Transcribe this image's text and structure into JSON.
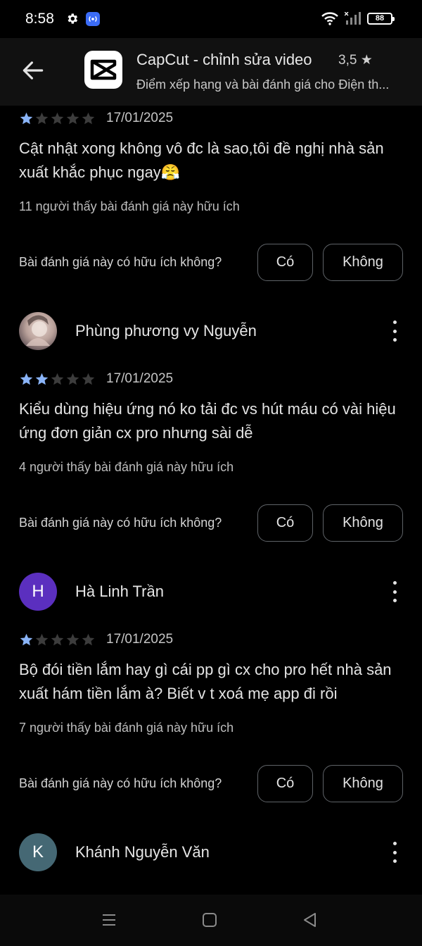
{
  "status_bar": {
    "time": "8:58",
    "battery": "88"
  },
  "header": {
    "app_title": "CapCut - chỉnh sửa video",
    "rating": "3,5",
    "subtitle": "Điểm xếp hạng và bài đánh giá cho Điện th..."
  },
  "helpful_question": "Bài đánh giá này có hữu ích không?",
  "yes_label": "Có",
  "no_label": "Không",
  "reviews": [
    {
      "stars": 1,
      "date": "17/01/2025",
      "text": "Cật nhật xong không vô đc là sao,tôi đề nghị nhà sản xuất khắc phục ngay😤",
      "helpful": "11 người thấy bài đánh giá này hữu ích"
    },
    {
      "author": "Phùng phương vy Nguyễn",
      "stars": 2,
      "date": "17/01/2025",
      "text": "Kiểu dùng hiệu ứng nó ko tải đc vs hút máu có vài hiệu ứng đơn giản cx pro nhưng sài dễ",
      "helpful": "4 người thấy bài đánh giá này hữu ích"
    },
    {
      "author": "Hà Linh Trần",
      "avatar_letter": "H",
      "avatar_color": "#5b2fbf",
      "stars": 1,
      "date": "17/01/2025",
      "text": "Bộ đói tiền lắm hay gì cái pp gì cx cho pro hết nhà sản xuất hám tiền lắm à? Biết v t xoá mẹ app đi rồi",
      "helpful": "7 người thấy bài đánh giá này hữu ích"
    },
    {
      "author": "Khánh Nguyễn Văn",
      "avatar_letter": "K",
      "avatar_color": "#456874"
    }
  ],
  "colors": {
    "star_filled": "#8ab4f8",
    "star_empty": "#3c3c3c"
  }
}
